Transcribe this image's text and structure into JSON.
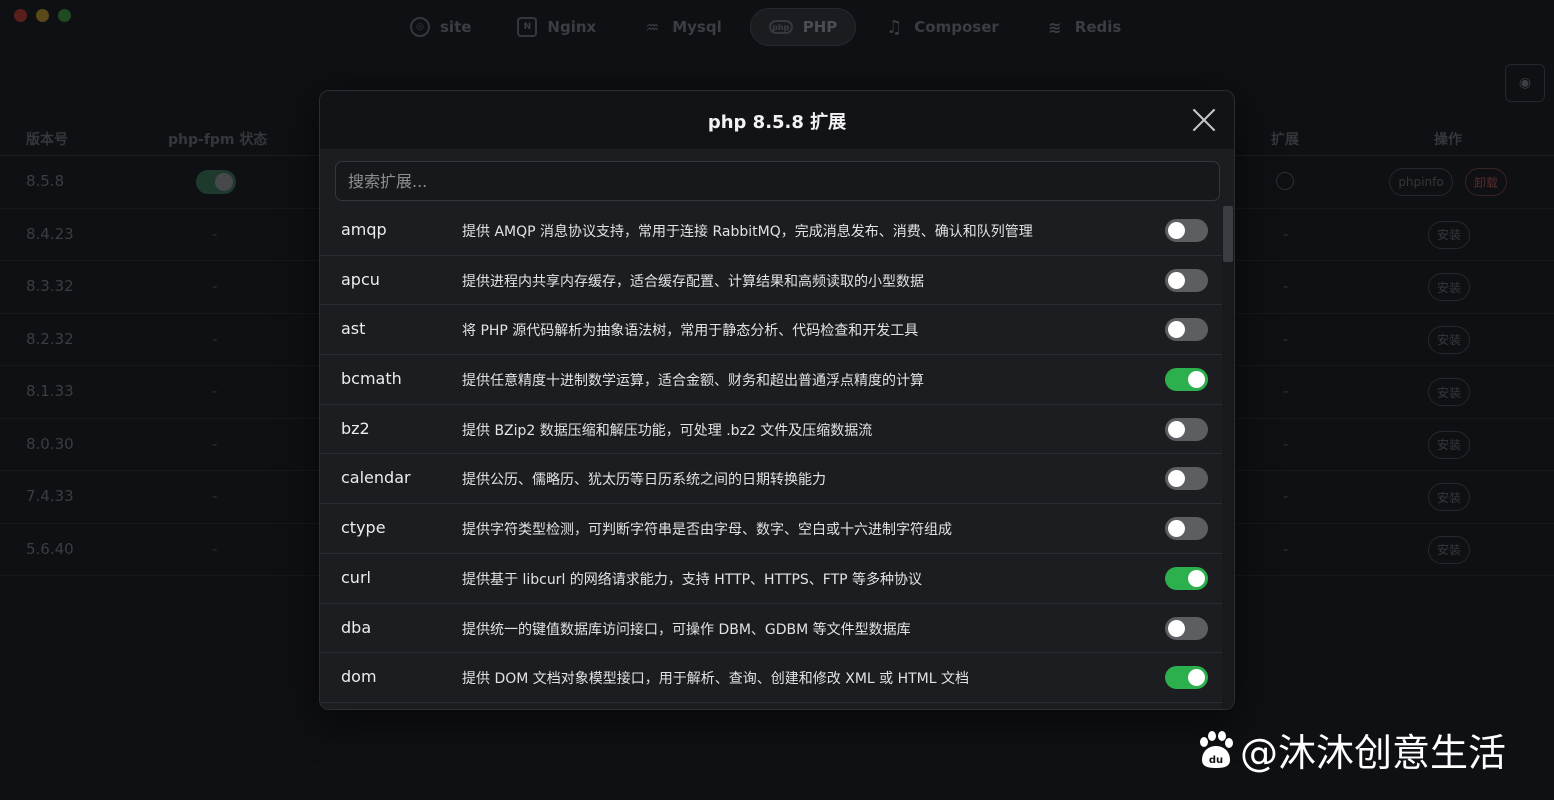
{
  "window": {
    "tabs": [
      {
        "label": "site",
        "icon": "compass-icon"
      },
      {
        "label": "Nginx",
        "icon": "nginx-icon"
      },
      {
        "label": "Mysql",
        "icon": "dolphin-icon"
      },
      {
        "label": "PHP",
        "icon": "php-icon",
        "active": true
      },
      {
        "label": "Composer",
        "icon": "music-note-icon"
      },
      {
        "label": "Redis",
        "icon": "stack-icon"
      }
    ]
  },
  "background_table": {
    "headers": {
      "version": "版本号",
      "fpm_status": "php-fpm 状态",
      "extensions": "扩展",
      "actions": "操作"
    },
    "rows": [
      {
        "version": "8.5.8",
        "fpm": "on",
        "phpinfo": "phpinfo",
        "uninstall": "卸载"
      },
      {
        "version": "8.4.23",
        "dash": "-",
        "dash2": "-",
        "install": "安装"
      },
      {
        "version": "8.3.32",
        "dash": "-",
        "dash2": "-",
        "install": "安装"
      },
      {
        "version": "8.2.32",
        "dash": "-",
        "dash2": "-",
        "install": "安装"
      },
      {
        "version": "8.1.33",
        "dash": "-",
        "dash2": "-",
        "install": "安装"
      },
      {
        "version": "8.0.30",
        "dash": "-",
        "dash2": "-",
        "install": "安装"
      },
      {
        "version": "7.4.33",
        "dash": "-",
        "dash2": "-",
        "install": "安装"
      },
      {
        "version": "5.6.40",
        "dash": "-",
        "dash2": "-",
        "install": "安装"
      }
    ]
  },
  "modal": {
    "title": "php 8.5.8 扩展",
    "search_placeholder": "搜索扩展...",
    "extensions": [
      {
        "name": "amqp",
        "desc": "提供 AMQP 消息协议支持，常用于连接 RabbitMQ，完成消息发布、消费、确认和队列管理",
        "enabled": false
      },
      {
        "name": "apcu",
        "desc": "提供进程内共享内存缓存，适合缓存配置、计算结果和高频读取的小型数据",
        "enabled": false
      },
      {
        "name": "ast",
        "desc": "将 PHP 源代码解析为抽象语法树，常用于静态分析、代码检查和开发工具",
        "enabled": false
      },
      {
        "name": "bcmath",
        "desc": "提供任意精度十进制数学运算，适合金额、财务和超出普通浮点精度的计算",
        "enabled": true
      },
      {
        "name": "bz2",
        "desc": "提供 BZip2 数据压缩和解压功能，可处理 .bz2 文件及压缩数据流",
        "enabled": false
      },
      {
        "name": "calendar",
        "desc": "提供公历、儒略历、犹太历等日历系统之间的日期转换能力",
        "enabled": false
      },
      {
        "name": "ctype",
        "desc": "提供字符类型检测，可判断字符串是否由字母、数字、空白或十六进制字符组成",
        "enabled": false
      },
      {
        "name": "curl",
        "desc": "提供基于 libcurl 的网络请求能力，支持 HTTP、HTTPS、FTP 等多种协议",
        "enabled": true
      },
      {
        "name": "dba",
        "desc": "提供统一的键值数据库访问接口，可操作 DBM、GDBM 等文件型数据库",
        "enabled": false
      },
      {
        "name": "dom",
        "desc": "提供 DOM 文档对象模型接口，用于解析、查询、创建和修改 XML 或 HTML 文档",
        "enabled": true
      }
    ]
  },
  "watermark": {
    "text": "@沐沐创意生活",
    "logo_text": "du"
  },
  "colors": {
    "toggle_on": "#2cb04d",
    "toggle_off": "#5c5e62",
    "modal_bg": "#1b1d21",
    "page_bg": "#0f1013"
  }
}
